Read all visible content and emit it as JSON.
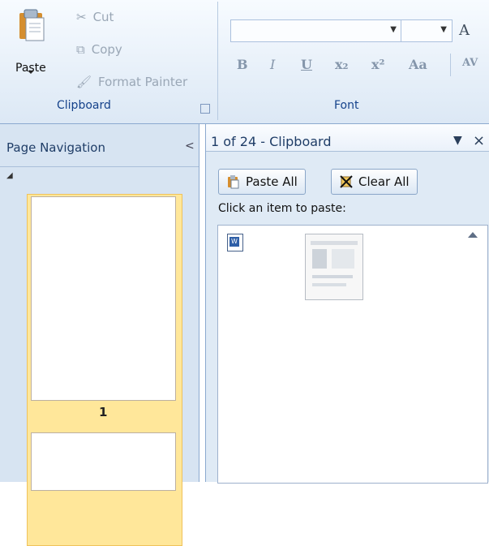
{
  "ribbon": {
    "clipboard": {
      "paste_label": "Paste",
      "cut_label": "Cut",
      "copy_label": "Copy",
      "format_painter_label": "Format Painter",
      "group_label": "Clipboard"
    },
    "font": {
      "group_label": "Font",
      "font_name_value": "",
      "font_size_value": "",
      "bold_label": "B",
      "italic_label": "I",
      "underline_label": "U",
      "subscript_label": "x₂",
      "superscript_label": "x²",
      "change_case_label": "Aa",
      "spacing_label": "AV",
      "grow_font_label": "A"
    }
  },
  "nav_pane": {
    "title": "Page Navigation",
    "collapse_glyph": "<",
    "expand_glyph": "◢",
    "current_page": "1"
  },
  "clipboard_pane": {
    "title": "1 of 24 - Clipboard",
    "paste_all_label": "Paste All",
    "clear_all_label": "Clear All",
    "hint": "Click an item to paste:",
    "close_glyph": "×",
    "menu_glyph": "▼"
  },
  "colors": {
    "ribbon_bg": "#dce8f5",
    "selected_page": "#ffe79a",
    "pane_bg": "#dfeaf5"
  }
}
